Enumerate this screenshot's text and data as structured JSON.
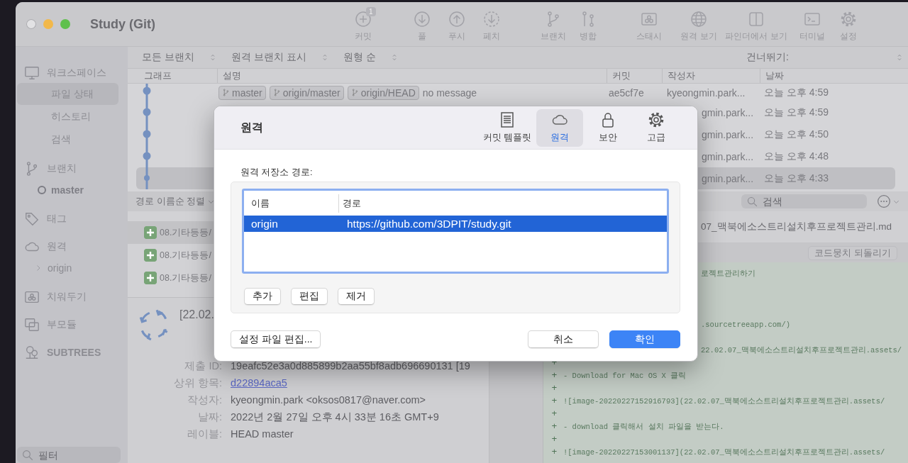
{
  "window": {
    "title": "Study (Git)"
  },
  "toolbar": [
    {
      "kind": "commit",
      "label": "커밋",
      "badge": "1"
    },
    {
      "kind": "pull",
      "label": "풀"
    },
    {
      "kind": "push",
      "label": "푸시"
    },
    {
      "kind": "fetch",
      "label": "페치"
    },
    {
      "kind": "branch",
      "label": "브랜치"
    },
    {
      "kind": "merge",
      "label": "병합"
    },
    {
      "kind": "stash",
      "label": "스태시"
    },
    {
      "kind": "remote",
      "label": "원격 보기"
    },
    {
      "kind": "finder",
      "label": "파인더에서 보기"
    },
    {
      "kind": "terminal",
      "label": "터미널"
    },
    {
      "kind": "settings",
      "label": "설정"
    }
  ],
  "sidebar": {
    "sections": [
      {
        "label": "워크스페이스",
        "items": [
          {
            "kind": "view",
            "label": "파일 상태",
            "selected": true
          },
          {
            "kind": "view",
            "label": "히스토리",
            "selected": false
          },
          {
            "kind": "view",
            "label": "검색",
            "selected": false
          }
        ]
      },
      {
        "label": "브랜치",
        "items": [
          {
            "kind": "branch",
            "label": "master",
            "current": true
          }
        ]
      },
      {
        "label": "태그"
      },
      {
        "label": "원격",
        "items": [
          {
            "kind": "remote",
            "label": "origin",
            "expanded": false
          }
        ]
      },
      {
        "label": "치워두기"
      },
      {
        "label": "부모듈"
      },
      {
        "label": "SUBTREES"
      }
    ],
    "filter": {
      "placeholder": "필터"
    }
  },
  "history": {
    "filters": [
      "모든 브랜치",
      "원격 브랜치 표시",
      "원형 순"
    ],
    "jump_label": "건너뛰기:",
    "columns": [
      "그래프",
      "설명",
      "커밋",
      "작성자",
      "날짜"
    ],
    "rows": [
      {
        "selected": false,
        "tags": [
          "master",
          "origin/master",
          "origin/HEAD"
        ],
        "description": "no message",
        "commit": "ae5cf7e",
        "author": "kyeongmin.park...",
        "date": "오늘 오후 4:59"
      },
      {
        "selected": false,
        "author": "gmin.park...",
        "date": "오늘 오후 4:59"
      },
      {
        "selected": false,
        "author": "gmin.park...",
        "date": "오늘 오후 4:50"
      },
      {
        "selected": false,
        "author": "gmin.park...",
        "date": "오늘 오후 4:48"
      },
      {
        "selected": true,
        "author": "gmin.park...",
        "date": "오늘 오후 4:33"
      }
    ]
  },
  "files": {
    "sort": "경로 이름순 정렬",
    "items": [
      {
        "path": "08.기타등등/",
        "selected": true
      },
      {
        "path": "08.기타등등/",
        "selected": false
      },
      {
        "path": "08.기타등등/",
        "selected": false
      }
    ]
  },
  "details": {
    "title": "[22.02.",
    "fields": [
      {
        "kind": "text",
        "label": "제출 ID:",
        "value": "19eafc52e3a0d885899b2aa55bf8adb696690131 [19"
      },
      {
        "kind": "link",
        "label": "상위 항목:",
        "value": "d22894aca5"
      },
      {
        "kind": "text",
        "label": "작성자:",
        "value": "kyeongmin.park <oksos0817@naver.com>"
      },
      {
        "kind": "text",
        "label": "날짜:",
        "value": "2022년 2월 27일 오후 4시 33분 16초 GMT+9"
      },
      {
        "kind": "text",
        "label": "레이블:",
        "value": "HEAD master"
      }
    ]
  },
  "diff": {
    "search": {
      "placeholder": "검색"
    },
    "file": "07_맥북에소스트리설치후프로젝트관리.md",
    "hunk_button": "코드뭉치 되돌리기",
    "lines": [
      {
        "kind": "covered",
        "text": "로젝트관리하기"
      },
      {
        "kind": "covered"
      },
      {
        "kind": "covered"
      },
      {
        "kind": "covered"
      },
      {
        "kind": "covered",
        "text": ".sourcetreeapp.com/)"
      },
      {
        "kind": "covered"
      },
      {
        "kind": "covered",
        "text": "22.02.07_맥북에소스트리설치후프로젝트관리.assets/"
      },
      {
        "kind": "added",
        "marker": "+"
      },
      {
        "kind": "added",
        "marker": "+",
        "text": "- Download for Mac OS X 클릭"
      },
      {
        "kind": "added",
        "marker": "+"
      },
      {
        "kind": "added",
        "marker": "+",
        "text": "![image-20220227152916793](22.02.07_맥북에소스트리설치후프로젝트관리.assets/"
      },
      {
        "kind": "added",
        "marker": "+"
      },
      {
        "kind": "added",
        "marker": "+",
        "text": "- download 클릭해서 설치 파일을 받는다."
      },
      {
        "kind": "added",
        "marker": "+"
      },
      {
        "kind": "added",
        "marker": "+",
        "text": "![image-20220227153001137](22.02.07_맥북에소스트리설치후프로젝트관리.assets/"
      }
    ]
  },
  "dialog": {
    "title": "원격",
    "tabs": [
      {
        "kind": "template",
        "label": "커밋 템플릿",
        "selected": false
      },
      {
        "kind": "remote",
        "label": "원격",
        "selected": true
      },
      {
        "kind": "security",
        "label": "보안",
        "selected": false
      },
      {
        "kind": "advanced",
        "label": "고급",
        "selected": false
      }
    ],
    "remotes_label": "원격 저장소 경로:",
    "columns": [
      "이름",
      "경로"
    ],
    "remotes": [
      {
        "name": "origin",
        "url": "https://github.com/3DPIT/study.git",
        "selected": true
      }
    ],
    "list_buttons": [
      "추가",
      "편집",
      "제거"
    ],
    "edit_config": "설정 파일 편집...",
    "buttons": [
      {
        "kind": "secondary",
        "label": "취소"
      },
      {
        "kind": "primary",
        "label": "확인"
      }
    ]
  }
}
